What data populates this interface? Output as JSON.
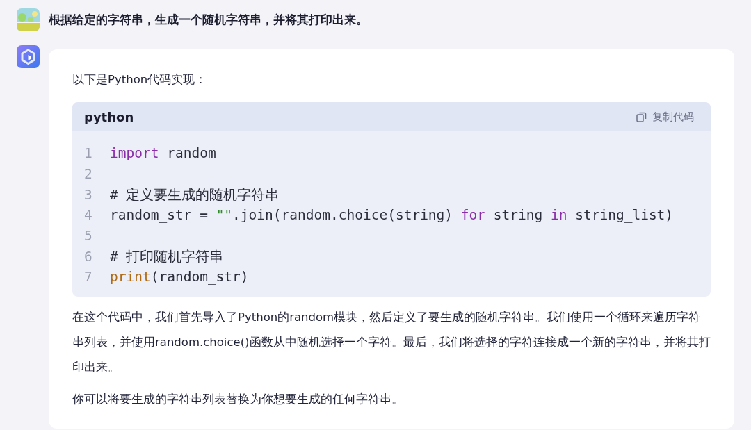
{
  "user_message": {
    "text": "根据给定的字符串，生成一个随机字符串，并将其打印出来。"
  },
  "reply": {
    "intro": "以下是Python代码实现：",
    "code_block": {
      "language": "python",
      "copy_button": "复制代码",
      "lines": [
        {
          "number": "1",
          "tokens": [
            {
              "kind": "keyword",
              "text": "import"
            },
            {
              "kind": "plain",
              "text": " random"
            }
          ]
        },
        {
          "number": "2"
        },
        {
          "number": "3",
          "tokens": [
            {
              "kind": "comment",
              "text": "# 定义要生成的随机字符串"
            }
          ]
        },
        {
          "number": "4",
          "tokens": [
            {
              "kind": "plain",
              "text": "random_str = "
            },
            {
              "kind": "string",
              "text": "\"\""
            },
            {
              "kind": "plain",
              "text": ".join(random.choice(string) "
            },
            {
              "kind": "keyword",
              "text": "for"
            },
            {
              "kind": "plain",
              "text": " string "
            },
            {
              "kind": "keyword",
              "text": "in"
            },
            {
              "kind": "plain",
              "text": " string_list)"
            }
          ]
        },
        {
          "number": "5"
        },
        {
          "number": "6",
          "tokens": [
            {
              "kind": "comment",
              "text": "# 打印随机字符串"
            }
          ]
        },
        {
          "number": "7",
          "tokens": [
            {
              "kind": "builtin",
              "text": "print"
            },
            {
              "kind": "plain",
              "text": "(random_str)"
            }
          ]
        }
      ]
    },
    "paragraphs": [
      "在这个代码中，我们首先导入了Python的random模块，然后定义了要生成的随机字符串。我们使用一个循环来遍历字符串列表，并使用random.choice()函数从中随机选择一个字符。最后，我们将选择的字符连接成一个新的字符串，并将其打印出来。",
      "你可以将要生成的字符串列表替换为你想要生成的任何字符串。"
    ]
  }
}
